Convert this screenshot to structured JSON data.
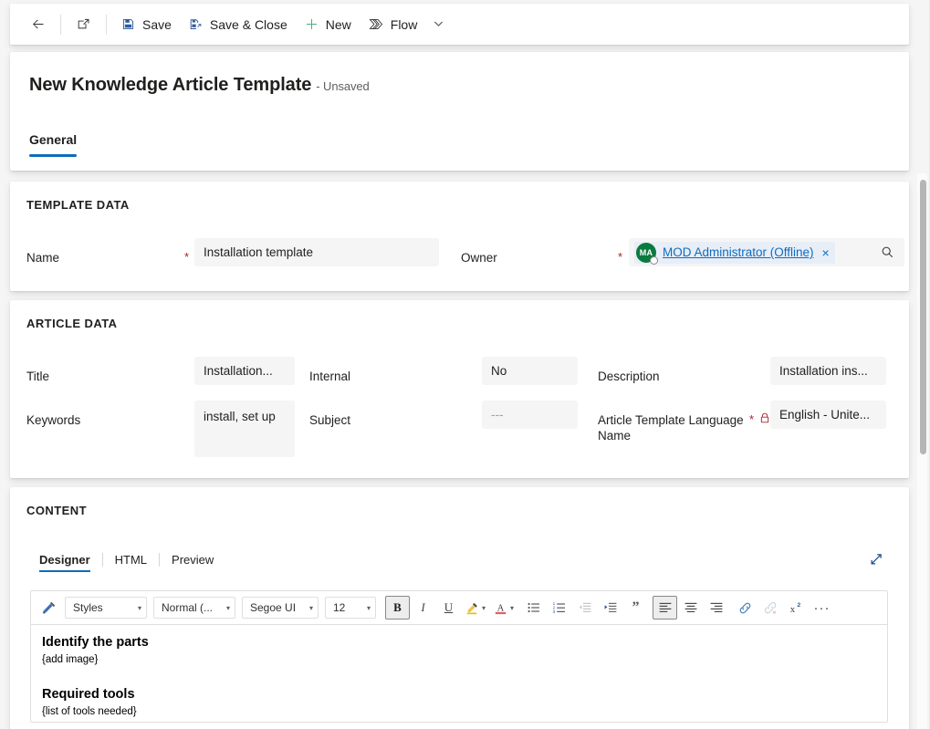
{
  "commandbar": {
    "back": {
      "label": "",
      "icon": "back-arrow-icon"
    },
    "popout": {
      "label": "",
      "icon": "open-in-new-window-icon"
    },
    "save": {
      "label": "Save",
      "icon": "save-icon"
    },
    "save_close": {
      "label": "Save & Close",
      "icon": "save-and-close-icon"
    },
    "new": {
      "label": "New",
      "icon": "plus-icon"
    },
    "flow": {
      "label": "Flow",
      "icon": "flow-icon"
    },
    "overflow": {
      "label": "",
      "icon": "chevron-down-icon"
    }
  },
  "header": {
    "title": "New Knowledge Article Template",
    "subtitle": "- Unsaved",
    "tabs": [
      {
        "label": "General",
        "active": true
      }
    ]
  },
  "template_data": {
    "section_title": "TEMPLATE DATA",
    "name": {
      "label": "Name",
      "required": true,
      "value": "Installation template",
      "placeholder": ""
    },
    "owner": {
      "label": "Owner",
      "required": true,
      "avatar_initials": "MA",
      "avatar_color": "#0b7a3e",
      "value": "MOD Administrator (Offline)",
      "remove_label": "×",
      "search_icon": "search-icon"
    }
  },
  "article_data": {
    "section_title": "ARTICLE DATA",
    "fields": [
      {
        "label": "Title",
        "value": "Installation...",
        "required": false,
        "locked": false,
        "multiline": false,
        "muted": false
      },
      {
        "label": "Internal",
        "value": "No",
        "required": false,
        "locked": false,
        "multiline": false,
        "muted": false
      },
      {
        "label": "Description",
        "value": "Installation ins...",
        "required": false,
        "locked": false,
        "multiline": false,
        "muted": false
      },
      {
        "label": "Keywords",
        "value": "install, set up",
        "required": false,
        "locked": false,
        "multiline": true,
        "muted": false
      },
      {
        "label": "Subject",
        "value": "---",
        "required": false,
        "locked": false,
        "multiline": false,
        "muted": true
      },
      {
        "label": "Article Template Language Name",
        "value": "English - Unite...",
        "required": true,
        "locked": true,
        "multiline": false,
        "muted": false
      }
    ]
  },
  "content": {
    "section_title": "CONTENT",
    "tabs": [
      {
        "label": "Designer",
        "active": true
      },
      {
        "label": "HTML",
        "active": false
      },
      {
        "label": "Preview",
        "active": false
      }
    ],
    "expand": {
      "icon": "expand-diagonal-icon",
      "label": ""
    },
    "toolbar": {
      "format_painter": {
        "icon": "format-painter-icon",
        "label": ""
      },
      "styles": {
        "label": "Styles",
        "caret": "▾"
      },
      "paragraph_format": {
        "label": "Normal (...",
        "caret": "▾"
      },
      "font_family": {
        "label": "Segoe UI",
        "caret": "▾"
      },
      "font_size": {
        "label": "12",
        "caret": "▾"
      },
      "bold": {
        "icon": "bold-icon",
        "label": "B",
        "active": true
      },
      "italic": {
        "icon": "italic-icon",
        "label": "I",
        "active": false
      },
      "underline": {
        "icon": "underline-icon",
        "label": "U",
        "active": false
      },
      "highlight": {
        "icon": "text-highlight-color-icon",
        "caret": "▾"
      },
      "font_color": {
        "icon": "font-color-icon",
        "caret": "▾"
      },
      "bulleted_list": {
        "icon": "bulleted-list-icon"
      },
      "numbered_list": {
        "icon": "numbered-list-icon"
      },
      "decrease_indent": {
        "icon": "decrease-indent-icon",
        "disabled": true
      },
      "increase_indent": {
        "icon": "increase-indent-icon",
        "disabled": false
      },
      "blockquote": {
        "icon": "blockquote-icon",
        "label": "”"
      },
      "align_left": {
        "icon": "align-left-icon",
        "active": true
      },
      "align_center": {
        "icon": "align-center-icon",
        "active": false
      },
      "align_right": {
        "icon": "align-right-icon",
        "active": false
      },
      "insert_link": {
        "icon": "link-icon",
        "disabled": false
      },
      "remove_link": {
        "icon": "unlink-icon",
        "disabled": true
      },
      "superscript": {
        "icon": "superscript-icon"
      },
      "more": {
        "icon": "more-options-icon",
        "label": "···"
      }
    },
    "body": [
      {
        "type": "heading",
        "text": "Identify the parts"
      },
      {
        "type": "paragraph",
        "text": "{add image}"
      },
      {
        "type": "spacer",
        "text": ""
      },
      {
        "type": "heading",
        "text": "Required tools"
      },
      {
        "type": "paragraph",
        "text": "{list of tools needed}"
      }
    ]
  },
  "colors": {
    "accent": "#0f6cbd",
    "page_background": "#f5f5f5",
    "card_background": "#ffffff",
    "field_background": "#f5f5f5",
    "required_star": "#a4262c",
    "link": "#0f6cbd",
    "new_icon_green": "#4caf82"
  }
}
